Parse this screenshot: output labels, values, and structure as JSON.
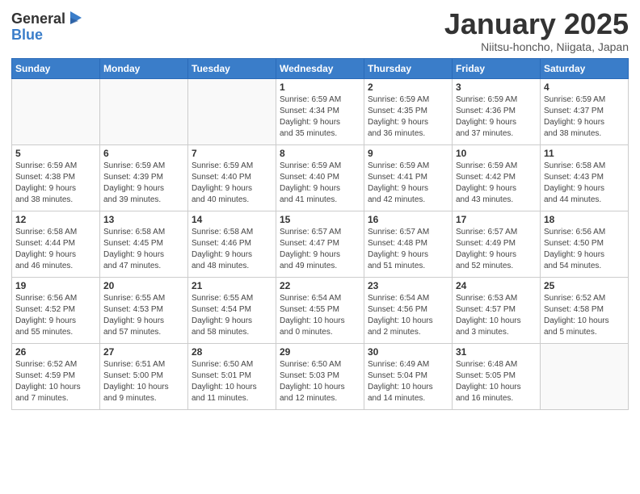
{
  "logo": {
    "general": "General",
    "blue": "Blue"
  },
  "header": {
    "month": "January 2025",
    "location": "Niitsu-honcho, Niigata, Japan"
  },
  "weekdays": [
    "Sunday",
    "Monday",
    "Tuesday",
    "Wednesday",
    "Thursday",
    "Friday",
    "Saturday"
  ],
  "weeks": [
    [
      {
        "day": "",
        "info": ""
      },
      {
        "day": "",
        "info": ""
      },
      {
        "day": "",
        "info": ""
      },
      {
        "day": "1",
        "info": "Sunrise: 6:59 AM\nSunset: 4:34 PM\nDaylight: 9 hours\nand 35 minutes."
      },
      {
        "day": "2",
        "info": "Sunrise: 6:59 AM\nSunset: 4:35 PM\nDaylight: 9 hours\nand 36 minutes."
      },
      {
        "day": "3",
        "info": "Sunrise: 6:59 AM\nSunset: 4:36 PM\nDaylight: 9 hours\nand 37 minutes."
      },
      {
        "day": "4",
        "info": "Sunrise: 6:59 AM\nSunset: 4:37 PM\nDaylight: 9 hours\nand 38 minutes."
      }
    ],
    [
      {
        "day": "5",
        "info": "Sunrise: 6:59 AM\nSunset: 4:38 PM\nDaylight: 9 hours\nand 38 minutes."
      },
      {
        "day": "6",
        "info": "Sunrise: 6:59 AM\nSunset: 4:39 PM\nDaylight: 9 hours\nand 39 minutes."
      },
      {
        "day": "7",
        "info": "Sunrise: 6:59 AM\nSunset: 4:40 PM\nDaylight: 9 hours\nand 40 minutes."
      },
      {
        "day": "8",
        "info": "Sunrise: 6:59 AM\nSunset: 4:40 PM\nDaylight: 9 hours\nand 41 minutes."
      },
      {
        "day": "9",
        "info": "Sunrise: 6:59 AM\nSunset: 4:41 PM\nDaylight: 9 hours\nand 42 minutes."
      },
      {
        "day": "10",
        "info": "Sunrise: 6:59 AM\nSunset: 4:42 PM\nDaylight: 9 hours\nand 43 minutes."
      },
      {
        "day": "11",
        "info": "Sunrise: 6:58 AM\nSunset: 4:43 PM\nDaylight: 9 hours\nand 44 minutes."
      }
    ],
    [
      {
        "day": "12",
        "info": "Sunrise: 6:58 AM\nSunset: 4:44 PM\nDaylight: 9 hours\nand 46 minutes."
      },
      {
        "day": "13",
        "info": "Sunrise: 6:58 AM\nSunset: 4:45 PM\nDaylight: 9 hours\nand 47 minutes."
      },
      {
        "day": "14",
        "info": "Sunrise: 6:58 AM\nSunset: 4:46 PM\nDaylight: 9 hours\nand 48 minutes."
      },
      {
        "day": "15",
        "info": "Sunrise: 6:57 AM\nSunset: 4:47 PM\nDaylight: 9 hours\nand 49 minutes."
      },
      {
        "day": "16",
        "info": "Sunrise: 6:57 AM\nSunset: 4:48 PM\nDaylight: 9 hours\nand 51 minutes."
      },
      {
        "day": "17",
        "info": "Sunrise: 6:57 AM\nSunset: 4:49 PM\nDaylight: 9 hours\nand 52 minutes."
      },
      {
        "day": "18",
        "info": "Sunrise: 6:56 AM\nSunset: 4:50 PM\nDaylight: 9 hours\nand 54 minutes."
      }
    ],
    [
      {
        "day": "19",
        "info": "Sunrise: 6:56 AM\nSunset: 4:52 PM\nDaylight: 9 hours\nand 55 minutes."
      },
      {
        "day": "20",
        "info": "Sunrise: 6:55 AM\nSunset: 4:53 PM\nDaylight: 9 hours\nand 57 minutes."
      },
      {
        "day": "21",
        "info": "Sunrise: 6:55 AM\nSunset: 4:54 PM\nDaylight: 9 hours\nand 58 minutes."
      },
      {
        "day": "22",
        "info": "Sunrise: 6:54 AM\nSunset: 4:55 PM\nDaylight: 10 hours\nand 0 minutes."
      },
      {
        "day": "23",
        "info": "Sunrise: 6:54 AM\nSunset: 4:56 PM\nDaylight: 10 hours\nand 2 minutes."
      },
      {
        "day": "24",
        "info": "Sunrise: 6:53 AM\nSunset: 4:57 PM\nDaylight: 10 hours\nand 3 minutes."
      },
      {
        "day": "25",
        "info": "Sunrise: 6:52 AM\nSunset: 4:58 PM\nDaylight: 10 hours\nand 5 minutes."
      }
    ],
    [
      {
        "day": "26",
        "info": "Sunrise: 6:52 AM\nSunset: 4:59 PM\nDaylight: 10 hours\nand 7 minutes."
      },
      {
        "day": "27",
        "info": "Sunrise: 6:51 AM\nSunset: 5:00 PM\nDaylight: 10 hours\nand 9 minutes."
      },
      {
        "day": "28",
        "info": "Sunrise: 6:50 AM\nSunset: 5:01 PM\nDaylight: 10 hours\nand 11 minutes."
      },
      {
        "day": "29",
        "info": "Sunrise: 6:50 AM\nSunset: 5:03 PM\nDaylight: 10 hours\nand 12 minutes."
      },
      {
        "day": "30",
        "info": "Sunrise: 6:49 AM\nSunset: 5:04 PM\nDaylight: 10 hours\nand 14 minutes."
      },
      {
        "day": "31",
        "info": "Sunrise: 6:48 AM\nSunset: 5:05 PM\nDaylight: 10 hours\nand 16 minutes."
      },
      {
        "day": "",
        "info": ""
      }
    ]
  ]
}
